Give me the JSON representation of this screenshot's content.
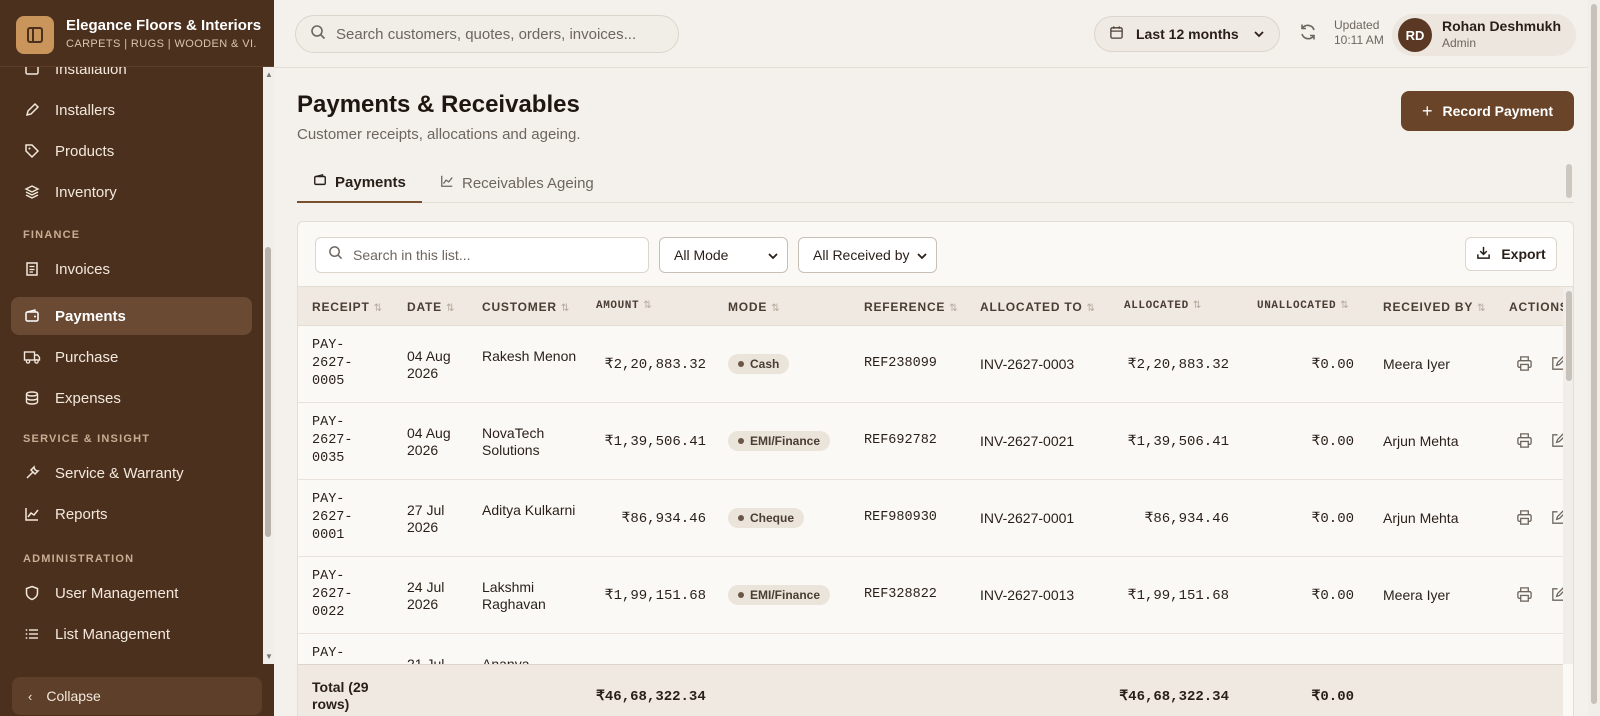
{
  "brand": {
    "name": "Elegance Floors & Interiors",
    "tagline": "CARPETS | RUGS | WOODEN & VI..."
  },
  "sidebar": {
    "items": [
      {
        "label": "Installation",
        "icon": "box-icon"
      },
      {
        "label": "Installers",
        "icon": "pencil-icon"
      },
      {
        "label": "Products",
        "icon": "tag-icon"
      },
      {
        "label": "Inventory",
        "icon": "layers-icon"
      },
      {
        "label": "Invoices",
        "icon": "receipt-icon"
      },
      {
        "label": "Payments",
        "icon": "wallet-icon",
        "active": true
      },
      {
        "label": "Purchase",
        "icon": "truck-icon"
      },
      {
        "label": "Expenses",
        "icon": "database-icon"
      },
      {
        "label": "Service & Warranty",
        "icon": "wrench-icon"
      },
      {
        "label": "Reports",
        "icon": "chart-line-icon"
      },
      {
        "label": "User Management",
        "icon": "shield-icon"
      },
      {
        "label": "List Management",
        "icon": "list-icon"
      }
    ],
    "sections": {
      "finance": "FINANCE",
      "service": "SERVICE & INSIGHT",
      "admin": "ADMINISTRATION"
    },
    "collapse_label": "Collapse"
  },
  "header": {
    "search_placeholder": "Search customers, quotes, orders, invoices...",
    "period": "Last 12 months",
    "updated_label": "Updated",
    "updated_time": "10:11 AM",
    "user": {
      "initials": "RD",
      "name": "Rohan Deshmukh",
      "role": "Admin"
    }
  },
  "page": {
    "title": "Payments & Receivables",
    "subtitle": "Customer receipts, allocations and ageing.",
    "record_button": "Record Payment"
  },
  "tabs": [
    {
      "label": "Payments",
      "active": true
    },
    {
      "label": "Receivables Ageing",
      "active": false
    }
  ],
  "toolbar": {
    "search_placeholder": "Search in this list...",
    "mode_filter": "All Mode",
    "received_filter": "All Received by",
    "export_label": "Export"
  },
  "table": {
    "columns": {
      "receipt": "RECEIPT",
      "date": "DATE",
      "customer": "CUSTOMER",
      "amount": "AMOUNT",
      "mode": "MODE",
      "reference": "REFERENCE",
      "allocated_to": "ALLOCATED TO",
      "allocated": "ALLOCATED",
      "unallocated": "UNALLOCATED",
      "received_by": "RECEIVED BY",
      "actions": "ACTIONS"
    },
    "rows": [
      {
        "receipt": "PAY-2627-0005",
        "date": "04 Aug 2026",
        "customer": "Rakesh Menon",
        "amount": "₹2,20,883.32",
        "mode": "Cash",
        "reference": "REF238099",
        "allocated_to": "INV-2627-0003",
        "allocated": "₹2,20,883.32",
        "unallocated": "₹0.00",
        "received_by": "Meera Iyer"
      },
      {
        "receipt": "PAY-2627-0035",
        "date": "04 Aug 2026",
        "customer": "NovaTech Solutions",
        "amount": "₹1,39,506.41",
        "mode": "EMI/Finance",
        "reference": "REF692782",
        "allocated_to": "INV-2627-0021",
        "allocated": "₹1,39,506.41",
        "unallocated": "₹0.00",
        "received_by": "Arjun Mehta"
      },
      {
        "receipt": "PAY-2627-0001",
        "date": "27 Jul 2026",
        "customer": "Aditya Kulkarni",
        "amount": "₹86,934.46",
        "mode": "Cheque",
        "reference": "REF980930",
        "allocated_to": "INV-2627-0001",
        "allocated": "₹86,934.46",
        "unallocated": "₹0.00",
        "received_by": "Arjun Mehta"
      },
      {
        "receipt": "PAY-2627-0022",
        "date": "24 Jul 2026",
        "customer": "Lakshmi Raghavan",
        "amount": "₹1,99,151.68",
        "mode": "EMI/Finance",
        "reference": "REF328822",
        "allocated_to": "INV-2627-0013",
        "allocated": "₹1,99,151.68",
        "unallocated": "₹0.00",
        "received_by": "Meera Iyer"
      },
      {
        "receipt": "PAY-2627-",
        "date": "21 Jul",
        "customer": "Ananya",
        "amount": "",
        "mode": "",
        "reference": "",
        "allocated_to": "",
        "allocated": "",
        "unallocated": "",
        "received_by": ""
      }
    ],
    "footer": {
      "label": "Total (29 rows)",
      "amount": "₹46,68,322.34",
      "allocated": "₹46,68,322.34",
      "unallocated": "₹0.00"
    }
  },
  "colors": {
    "sidebar_bg": "#4b301e",
    "accent": "#6a4428",
    "page_bg": "#f4f1ec"
  }
}
